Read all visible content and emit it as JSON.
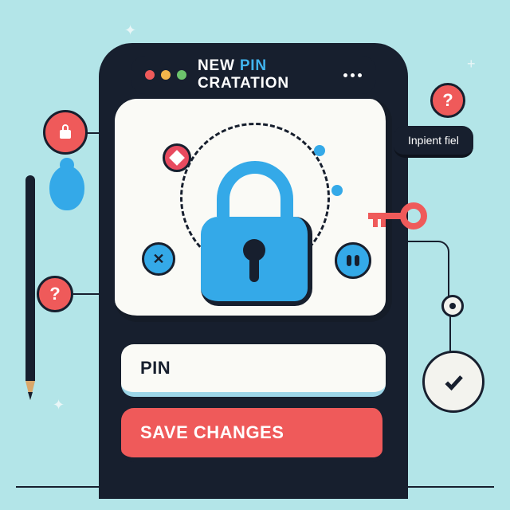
{
  "header": {
    "title_pre": "NEW ",
    "title_accent": "PIN",
    "title_post": " CRATATION"
  },
  "side_label": "Inpient fiel",
  "input": {
    "label": "PIN"
  },
  "actions": {
    "save": "SAVE CHANGES"
  },
  "badges": {
    "help": "?",
    "help_top": "?"
  }
}
